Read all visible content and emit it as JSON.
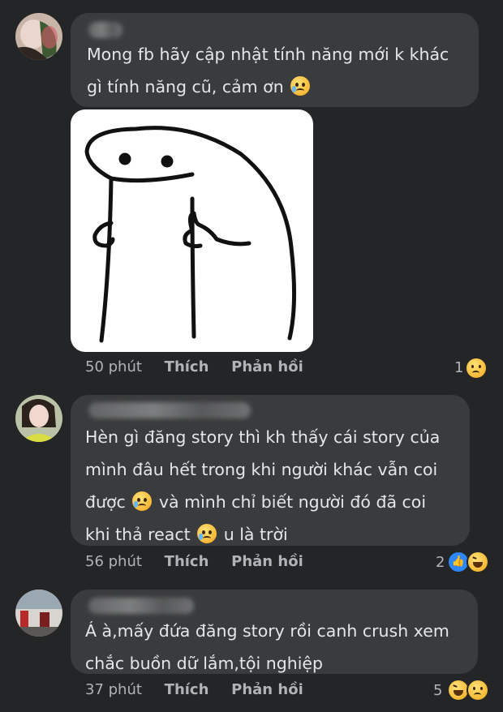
{
  "comments": [
    {
      "text_lines": [
        "Mong fb hãy cập nhật tính năng mới k khác",
        "gì tính năng cũ, cảm ơn"
      ],
      "emoji": [
        "crying-face"
      ],
      "has_sticker": true,
      "time": "50 phút",
      "like_label": "Thích",
      "reply_label": "Phản hồi",
      "reaction_count": "1",
      "reactions": [
        "sad"
      ]
    },
    {
      "text_lines": [
        "Hèn gì đăng story thì kh thấy cái story của",
        "mình đâu hết trong khi người khác vẫn coi",
        "được",
        "và mình chỉ biết người đó đã coi",
        "khi thả react",
        "u là trời"
      ],
      "emoji": [
        "crying-face",
        "crying-face"
      ],
      "time": "56 phút",
      "like_label": "Thích",
      "reply_label": "Phản hồi",
      "reaction_count": "2",
      "reactions": [
        "like",
        "haha"
      ]
    },
    {
      "text_lines": [
        "Á à,mấy đứa đăng story rồi canh crush xem",
        "chắc buồn dữ lắm,tội nghiệp"
      ],
      "time": "37 phút",
      "like_label": "Thích",
      "reply_label": "Phản hồi",
      "reaction_count": "5",
      "reactions": [
        "haha",
        "sad"
      ]
    }
  ]
}
